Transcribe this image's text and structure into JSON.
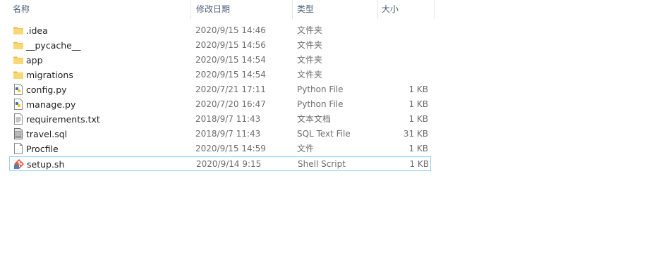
{
  "columns": {
    "name": "名称",
    "modified": "修改日期",
    "type": "类型",
    "size": "大小"
  },
  "files": [
    {
      "name": ".idea",
      "modified": "2020/9/15 14:46",
      "type": "文件夹",
      "size": "",
      "icon": "folder-icon"
    },
    {
      "name": "__pycache__",
      "modified": "2020/9/15 14:56",
      "type": "文件夹",
      "size": "",
      "icon": "folder-icon"
    },
    {
      "name": "app",
      "modified": "2020/9/15 14:54",
      "type": "文件夹",
      "size": "",
      "icon": "folder-icon"
    },
    {
      "name": "migrations",
      "modified": "2020/9/15 14:54",
      "type": "文件夹",
      "size": "",
      "icon": "folder-icon"
    },
    {
      "name": "config.py",
      "modified": "2020/7/21 17:11",
      "type": "Python File",
      "size": "1 KB",
      "icon": "python-file-icon"
    },
    {
      "name": "manage.py",
      "modified": "2020/7/20 16:47",
      "type": "Python File",
      "size": "1 KB",
      "icon": "python-file-icon"
    },
    {
      "name": "requirements.txt",
      "modified": "2018/9/7 11:43",
      "type": "文本文档",
      "size": "1 KB",
      "icon": "text-file-icon"
    },
    {
      "name": "travel.sql",
      "modified": "2018/9/7 11:43",
      "type": "SQL Text File",
      "size": "31 KB",
      "icon": "sql-file-icon"
    },
    {
      "name": "Procfile",
      "modified": "2020/9/15 14:59",
      "type": "文件",
      "size": "1 KB",
      "icon": "blank-file-icon"
    },
    {
      "name": "setup.sh",
      "modified": "2020/9/14 9:15",
      "type": "Shell Script",
      "size": "1 KB",
      "icon": "git-shell-file-icon",
      "selected": true
    }
  ],
  "colors": {
    "header_text": "#4c607a",
    "selection_border": "#99d1ff",
    "folder": "#f8d775"
  }
}
